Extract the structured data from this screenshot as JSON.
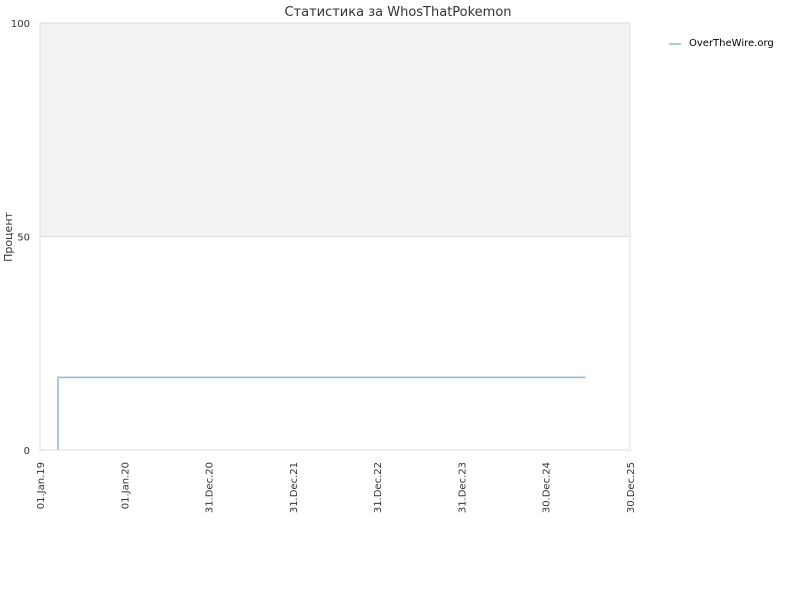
{
  "chart_data": {
    "type": "line",
    "title": "Статистика за WhosThatPokemon",
    "xlabel": "",
    "ylabel": "Процент",
    "x_ticks": [
      "01.Jan.19",
      "01.Jan.20",
      "31.Dec.20",
      "31.Dec.21",
      "31.Dec.22",
      "31.Dec.23",
      "30.Dec.24",
      "30.Dec.25"
    ],
    "y_ticks": [
      "0",
      "50",
      "100"
    ],
    "ylim": [
      0,
      100
    ],
    "xlim": [
      "2019-01-01",
      "2025-12-30"
    ],
    "grid": true,
    "legend_position": "top-right",
    "band": {
      "from": 50,
      "to": 100,
      "color": "#f2f2f2"
    },
    "series": [
      {
        "name": "OverTheWire.org",
        "color": "#8fb8dc",
        "points": [
          {
            "x": "2019-03-20",
            "y": 0
          },
          {
            "x": "2019-03-20",
            "y": 17
          },
          {
            "x": "2025-06-20",
            "y": 17
          }
        ]
      }
    ]
  }
}
